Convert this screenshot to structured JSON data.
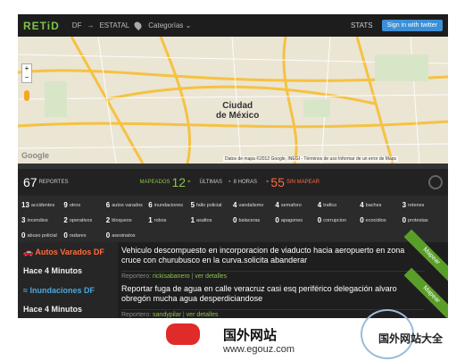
{
  "topbar": {
    "logo": "RETiD",
    "region": "DF",
    "arrow": "→",
    "state": "ESTATAL",
    "categories": "Categorías",
    "stats": "STATS",
    "twitter": "Sign in with twitter"
  },
  "map": {
    "city": "Ciudad\nde México",
    "footer": "Datos de mapa ©2012 Google, INEGI - Términos de uso  Informar de un error de Maps",
    "google": "Google",
    "zoom_in": "+",
    "zoom_out": "−"
  },
  "summary": {
    "total": "67",
    "total_label": "REPORTES",
    "mapped_label": "MAPEADOS",
    "mapped": "12",
    "last_label": "ÚLTIMAS",
    "hours": "8 HORAS",
    "unmapped": "55",
    "unmapped_label": "SIN MAPEAR"
  },
  "categories": [
    {
      "n": "13",
      "l": "accidentes"
    },
    {
      "n": "9",
      "l": "otros"
    },
    {
      "n": "6",
      "l": "autos varados"
    },
    {
      "n": "6",
      "l": "inundaciones"
    },
    {
      "n": "5",
      "l": "fallo policial"
    },
    {
      "n": "4",
      "l": "vandalismo"
    },
    {
      "n": "4",
      "l": "semaforo"
    },
    {
      "n": "4",
      "l": "trafico"
    },
    {
      "n": "4",
      "l": "baches"
    },
    {
      "n": "3",
      "l": "retenes"
    },
    {
      "n": "3",
      "l": "incendios"
    },
    {
      "n": "2",
      "l": "operativos"
    },
    {
      "n": "2",
      "l": "bloqueos"
    },
    {
      "n": "1",
      "l": "robos"
    },
    {
      "n": "1",
      "l": "asaltos"
    },
    {
      "n": "0",
      "l": "balaceras"
    },
    {
      "n": "0",
      "l": "apagones"
    },
    {
      "n": "0",
      "l": "corrupcion"
    },
    {
      "n": "0",
      "l": "ecocidios"
    },
    {
      "n": "0",
      "l": "protestas"
    },
    {
      "n": "0",
      "l": "abuso policial"
    },
    {
      "n": "0",
      "l": "radares"
    },
    {
      "n": "0",
      "l": "asesinatos"
    }
  ],
  "feed": [
    {
      "category": "Autos Varados DF",
      "time": "Hace 4 Minutos",
      "text": "Vehiculo descompuesto en incorporacion de viaducto hacia aeropuerto en zona cruce con churubusco en la curva.solicita abanderar",
      "reporter_label": "Reportero:",
      "reporter": "rickisabanero",
      "details": "ver detalles",
      "ribbon": "Mapear",
      "color": "#ff6a3d"
    },
    {
      "category": "Inundaciones DF",
      "time": "Hace 4 Minutos",
      "text": "Reportar fuga de agua en calle veracruz casi esq periférico delegación alvaro obregón mucha agua desperdiciandose",
      "reporter_label": "Reportero:",
      "reporter": "sandypilar",
      "details": "ver detalles",
      "ribbon": "Mapear",
      "color": "#4aa8e0"
    }
  ],
  "watermark": {
    "title": "国外网站",
    "url": "www.egouz.com",
    "right": "国外网站大全"
  }
}
